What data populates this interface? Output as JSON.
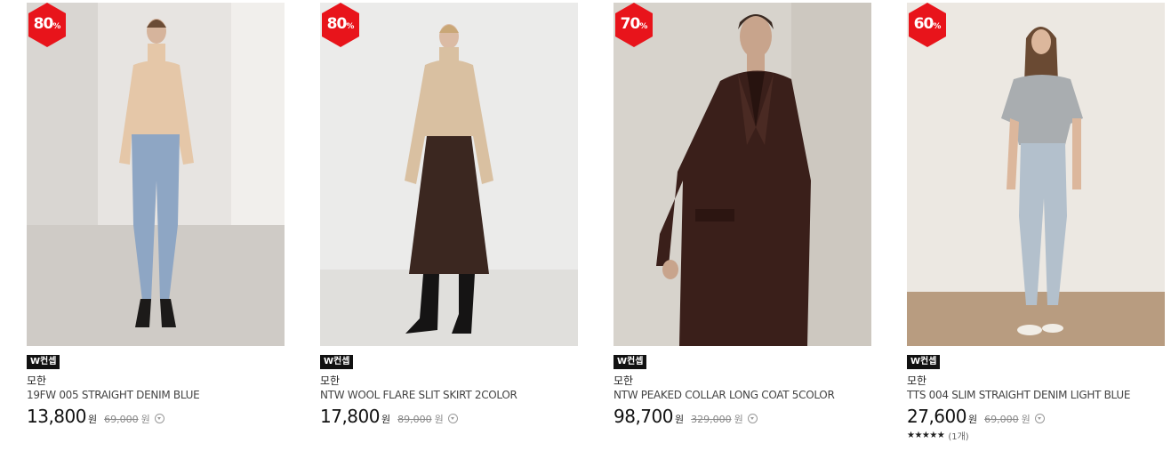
{
  "products": [
    {
      "discount": "80",
      "discount_unit": "%",
      "tag": "W컨셉",
      "brand": "모한",
      "name": "19FW 005 STRAIGHT DENIM BLUE",
      "price": "13,800",
      "price_unit": "원",
      "original_price": "69,000",
      "original_unit": "원",
      "image": "woman-beige-turtleneck-denim-jeans"
    },
    {
      "discount": "80",
      "discount_unit": "%",
      "tag": "W컨셉",
      "brand": "모한",
      "name": "NTW WOOL FLARE SLIT SKIRT 2COLOR",
      "price": "17,800",
      "price_unit": "원",
      "original_price": "89,000",
      "original_unit": "원",
      "image": "woman-beige-sweater-brown-skirt"
    },
    {
      "discount": "70",
      "discount_unit": "%",
      "tag": "W컨셉",
      "brand": "모한",
      "name": "NTW PEAKED COLLAR LONG COAT 5COLOR",
      "price": "98,700",
      "price_unit": "원",
      "original_price": "329,000",
      "original_unit": "원",
      "image": "woman-dark-brown-long-coat"
    },
    {
      "discount": "60",
      "discount_unit": "%",
      "tag": "W컨셉",
      "brand": "모한",
      "name": "TTS 004 SLIM STRAIGHT DENIM LIGHT BLUE",
      "price": "27,600",
      "price_unit": "원",
      "original_price": "69,000",
      "original_unit": "원",
      "rating_stars": "★★★★★",
      "review_count": "(1개)",
      "image": "woman-gray-top-light-denim"
    }
  ],
  "colors": {
    "badge": "#e8141b",
    "tag_bg": "#111111",
    "price": "#111111",
    "original_price": "#888888"
  }
}
